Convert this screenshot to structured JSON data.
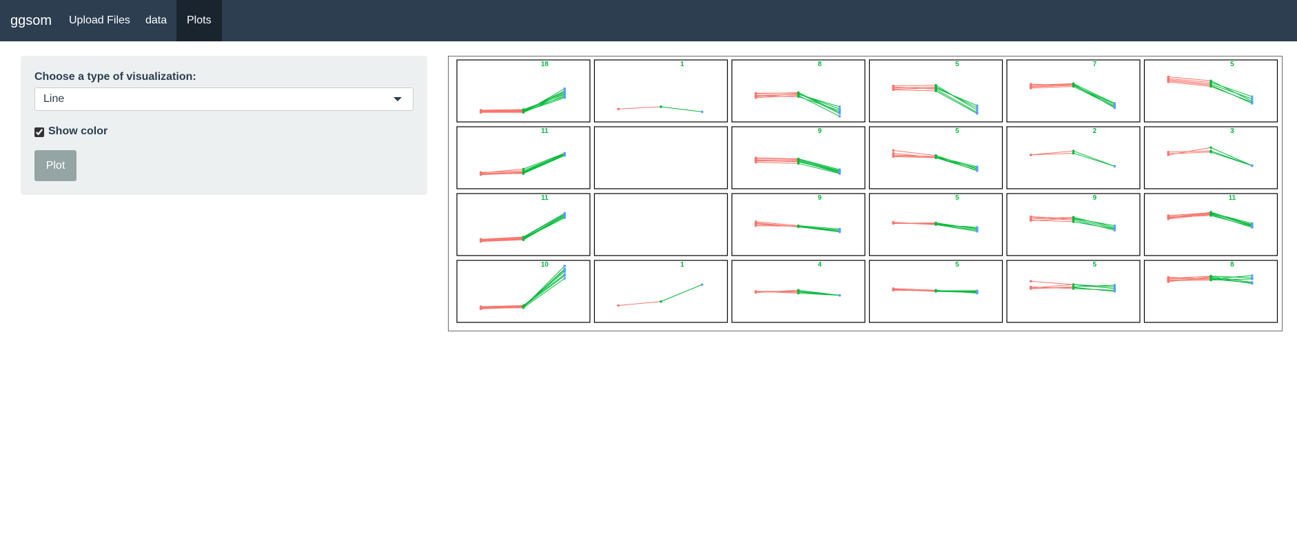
{
  "navbar": {
    "brand": "ggsom",
    "tabs": [
      {
        "label": "Upload Files",
        "active": false
      },
      {
        "label": "data",
        "active": false
      },
      {
        "label": "Plots",
        "active": true
      }
    ]
  },
  "sidebar": {
    "viz_label": "Choose a type of visualization:",
    "viz_selected": "Line",
    "caret_icon": "caret-down-icon",
    "show_color_label": "Show color",
    "show_color_checked": true,
    "plot_button": "Plot"
  },
  "colors": {
    "navbar_bg": "#2c3e50",
    "active_tab_bg": "#1a242f",
    "panel_bg": "#ecf0f1",
    "button_bg": "#95a5a6",
    "series_x1": "#f8766d",
    "series_x2": "#00ba38",
    "series_x3": "#619cff",
    "count_label": "#00ba38"
  },
  "chart_data": {
    "type": "line",
    "description": "Grid of SOM cells (4 rows x 6 columns); each cell shows parallel-coordinate lines of its members across 3 variables",
    "rows": 4,
    "cols": 6,
    "x": [
      1,
      2,
      3
    ],
    "ylim": [
      0,
      1
    ],
    "cells": [
      {
        "count": "18",
        "lines": [
          [
            0.12,
            0.12,
            0.42
          ],
          [
            0.13,
            0.13,
            0.46
          ],
          [
            0.14,
            0.14,
            0.5
          ],
          [
            0.12,
            0.13,
            0.38
          ],
          [
            0.15,
            0.16,
            0.4
          ],
          [
            0.16,
            0.17,
            0.44
          ],
          [
            0.13,
            0.12,
            0.54
          ],
          [
            0.15,
            0.15,
            0.48
          ]
        ]
      },
      {
        "count": "1",
        "lines": [
          [
            0.18,
            0.22,
            0.13
          ]
        ]
      },
      {
        "count": "8",
        "lines": [
          [
            0.4,
            0.45,
            0.18
          ],
          [
            0.45,
            0.47,
            0.12
          ],
          [
            0.38,
            0.42,
            0.05
          ],
          [
            0.42,
            0.44,
            0.22
          ],
          [
            0.46,
            0.46,
            0.1
          ],
          [
            0.41,
            0.4,
            0.15
          ]
        ]
      },
      {
        "count": "5",
        "lines": [
          [
            0.55,
            0.57,
            0.2
          ],
          [
            0.59,
            0.6,
            0.16
          ],
          [
            0.52,
            0.5,
            0.1
          ],
          [
            0.57,
            0.53,
            0.12
          ],
          [
            0.53,
            0.55,
            0.24
          ]
        ]
      },
      {
        "count": "7",
        "lines": [
          [
            0.58,
            0.62,
            0.2
          ],
          [
            0.62,
            0.6,
            0.27
          ],
          [
            0.55,
            0.58,
            0.22
          ],
          [
            0.6,
            0.63,
            0.28
          ],
          [
            0.57,
            0.6,
            0.24
          ]
        ]
      },
      {
        "count": "5",
        "lines": [
          [
            0.72,
            0.65,
            0.4
          ],
          [
            0.68,
            0.6,
            0.28
          ],
          [
            0.75,
            0.68,
            0.32
          ],
          [
            0.7,
            0.62,
            0.36
          ],
          [
            0.66,
            0.58,
            0.3
          ]
        ]
      },
      {
        "count": "11",
        "lines": [
          [
            0.22,
            0.25,
            0.58
          ],
          [
            0.2,
            0.23,
            0.55
          ],
          [
            0.24,
            0.27,
            0.57
          ],
          [
            0.21,
            0.24,
            0.56
          ],
          [
            0.23,
            0.3,
            0.58
          ],
          [
            0.22,
            0.22,
            0.54
          ]
        ]
      },
      {
        "count": "",
        "lines": []
      },
      {
        "count": "9",
        "lines": [
          [
            0.45,
            0.43,
            0.25
          ],
          [
            0.48,
            0.47,
            0.27
          ],
          [
            0.42,
            0.4,
            0.22
          ],
          [
            0.5,
            0.48,
            0.29
          ],
          [
            0.46,
            0.44,
            0.23
          ],
          [
            0.44,
            0.45,
            0.26
          ]
        ]
      },
      {
        "count": "5",
        "lines": [
          [
            0.58,
            0.5,
            0.32
          ],
          [
            0.53,
            0.52,
            0.27
          ],
          [
            0.55,
            0.52,
            0.34
          ],
          [
            0.63,
            0.54,
            0.3
          ],
          [
            0.52,
            0.5,
            0.28
          ]
        ]
      },
      {
        "count": "2",
        "lines": [
          [
            0.55,
            0.62,
            0.35
          ],
          [
            0.55,
            0.58,
            0.35
          ]
        ]
      },
      {
        "count": "3",
        "lines": [
          [
            0.55,
            0.68,
            0.36
          ],
          [
            0.6,
            0.62,
            0.36
          ],
          [
            0.57,
            0.6,
            0.36
          ]
        ]
      },
      {
        "count": "11",
        "lines": [
          [
            0.22,
            0.25,
            0.62
          ],
          [
            0.2,
            0.23,
            0.65
          ],
          [
            0.24,
            0.28,
            0.7
          ],
          [
            0.21,
            0.24,
            0.67
          ],
          [
            0.23,
            0.27,
            0.68
          ],
          [
            0.22,
            0.26,
            0.64
          ]
        ]
      },
      {
        "count": "",
        "lines": []
      },
      {
        "count": "9",
        "lines": [
          [
            0.52,
            0.46,
            0.37
          ],
          [
            0.48,
            0.47,
            0.4
          ],
          [
            0.55,
            0.48,
            0.42
          ],
          [
            0.5,
            0.47,
            0.38
          ],
          [
            0.53,
            0.46,
            0.4
          ]
        ]
      },
      {
        "count": "5",
        "lines": [
          [
            0.53,
            0.51,
            0.4
          ],
          [
            0.52,
            0.52,
            0.43
          ],
          [
            0.54,
            0.5,
            0.45
          ],
          [
            0.52,
            0.53,
            0.42
          ],
          [
            0.53,
            0.5,
            0.38
          ]
        ]
      },
      {
        "count": "9",
        "lines": [
          [
            0.6,
            0.63,
            0.45
          ],
          [
            0.63,
            0.58,
            0.4
          ],
          [
            0.57,
            0.61,
            0.48
          ],
          [
            0.64,
            0.6,
            0.43
          ],
          [
            0.58,
            0.55,
            0.42
          ]
        ]
      },
      {
        "count": "11",
        "lines": [
          [
            0.64,
            0.7,
            0.48
          ],
          [
            0.6,
            0.68,
            0.45
          ],
          [
            0.66,
            0.71,
            0.52
          ],
          [
            0.62,
            0.69,
            0.5
          ],
          [
            0.63,
            0.66,
            0.47
          ],
          [
            0.61,
            0.72,
            0.49
          ]
        ]
      },
      {
        "count": "10",
        "lines": [
          [
            0.2,
            0.22,
            0.95
          ],
          [
            0.22,
            0.24,
            0.85
          ],
          [
            0.21,
            0.23,
            0.78
          ],
          [
            0.19,
            0.22,
            0.9
          ],
          [
            0.23,
            0.25,
            0.8
          ],
          [
            0.2,
            0.21,
            0.73
          ],
          [
            0.22,
            0.24,
            0.88
          ]
        ]
      },
      {
        "count": "1",
        "lines": [
          [
            0.25,
            0.32,
            0.62
          ]
        ]
      },
      {
        "count": "4",
        "lines": [
          [
            0.5,
            0.5,
            0.43
          ],
          [
            0.48,
            0.52,
            0.43
          ],
          [
            0.5,
            0.47,
            0.43
          ],
          [
            0.49,
            0.49,
            0.43
          ]
        ]
      },
      {
        "count": "5",
        "lines": [
          [
            0.53,
            0.5,
            0.5
          ],
          [
            0.55,
            0.52,
            0.47
          ],
          [
            0.52,
            0.51,
            0.51
          ],
          [
            0.54,
            0.5,
            0.48
          ],
          [
            0.53,
            0.51,
            0.49
          ]
        ]
      },
      {
        "count": "5",
        "lines": [
          [
            0.68,
            0.62,
            0.55
          ],
          [
            0.55,
            0.58,
            0.61
          ],
          [
            0.58,
            0.55,
            0.52
          ],
          [
            0.56,
            0.62,
            0.58
          ],
          [
            0.55,
            0.57,
            0.5
          ]
        ]
      },
      {
        "count": "8",
        "lines": [
          [
            0.73,
            0.77,
            0.74
          ],
          [
            0.7,
            0.72,
            0.78
          ],
          [
            0.67,
            0.76,
            0.66
          ],
          [
            0.75,
            0.72,
            0.65
          ],
          [
            0.69,
            0.7,
            0.72
          ],
          [
            0.72,
            0.74,
            0.64
          ]
        ]
      }
    ]
  }
}
